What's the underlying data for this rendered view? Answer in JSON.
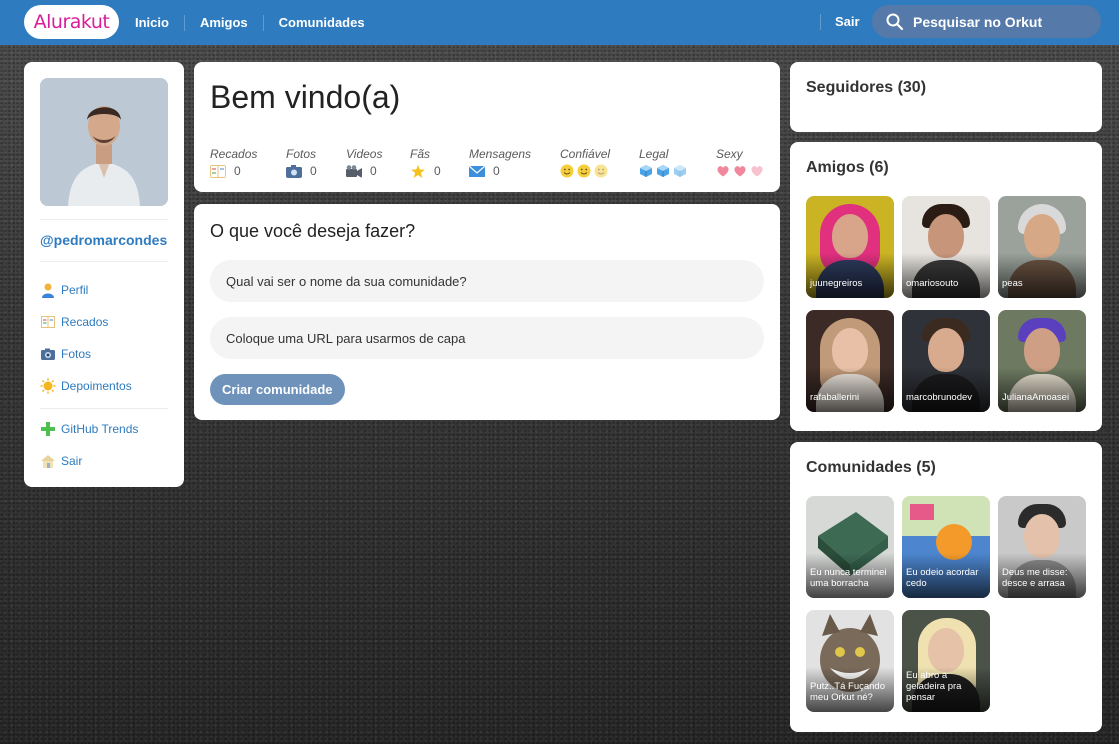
{
  "header": {
    "logo": "Alurakut",
    "nav": [
      "Inicio",
      "Amigos",
      "Comunidades"
    ],
    "logout": "Sair",
    "search_placeholder": "Pesquisar no Orkut"
  },
  "profile": {
    "username": "@pedromarcondes",
    "menu": [
      {
        "label": "Perfil",
        "icon": "user-icon"
      },
      {
        "label": "Recados",
        "icon": "book-icon"
      },
      {
        "label": "Fotos",
        "icon": "camera-icon"
      },
      {
        "label": "Depoimentos",
        "icon": "sun-icon"
      }
    ],
    "menu2": [
      {
        "label": "GitHub Trends",
        "icon": "plus-icon"
      },
      {
        "label": "Sair",
        "icon": "house-icon"
      }
    ]
  },
  "welcome": {
    "title": "Bem vindo(a)",
    "stats": [
      {
        "label": "Recados",
        "value": "0",
        "icon": "book-icon"
      },
      {
        "label": "Fotos",
        "value": "0",
        "icon": "camera-icon"
      },
      {
        "label": "Videos",
        "value": "0",
        "icon": "video-camera-icon"
      },
      {
        "label": "Fãs",
        "value": "0",
        "icon": "star-icon"
      },
      {
        "label": "Mensagens",
        "value": "0",
        "icon": "envelope-icon"
      }
    ],
    "ratings": [
      {
        "label": "Confiável",
        "icon": "smiley-icon"
      },
      {
        "label": "Legal",
        "icon": "ice-cube-icon"
      },
      {
        "label": "Sexy",
        "icon": "heart-icon"
      }
    ]
  },
  "form": {
    "title": "O que você deseja fazer?",
    "name_placeholder": "Qual vai ser o nome da sua comunidade?",
    "url_placeholder": "Coloque uma URL para usarmos de capa",
    "submit": "Criar comunidade"
  },
  "seguidores": {
    "title": "Seguidores (30)"
  },
  "amigos": {
    "title": "Amigos (6)",
    "items": [
      "juunegreiros",
      "omariosouto",
      "peas",
      "rafaballerini",
      "marcobrunodev",
      "JulianaAmoasei"
    ]
  },
  "comunidades": {
    "title": "Comunidades (5)",
    "items": [
      "Eu nunca terminei uma borracha",
      "Eu odeio acordar cedo",
      "Deus me disse: desce e arrasa",
      "Putz..Tá Fuçando meu Orkut né?",
      "Eu abro a geladeira pra pensar"
    ]
  },
  "colors": {
    "header": "#2e7bbf",
    "link": "#2e7bbf",
    "logo": "#d81d99",
    "button": "#6f92bb"
  }
}
